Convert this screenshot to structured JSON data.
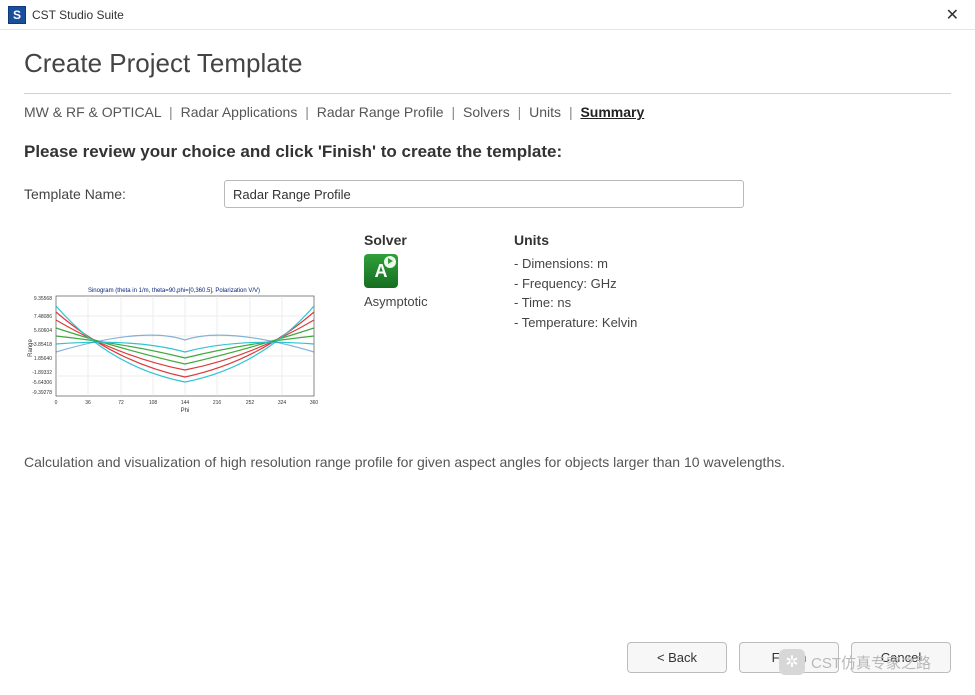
{
  "app": {
    "title": "CST Studio Suite"
  },
  "page": {
    "title": "Create Project Template"
  },
  "breadcrumbs": {
    "items": [
      {
        "label": "MW & RF & OPTICAL"
      },
      {
        "label": "Radar Applications"
      },
      {
        "label": "Radar Range Profile"
      },
      {
        "label": "Solvers"
      },
      {
        "label": "Units"
      },
      {
        "label": "Summary"
      }
    ],
    "sep": "|",
    "active_index": 5
  },
  "instruction": "Please review your choice and click 'Finish' to create the template:",
  "form": {
    "template_name_label": "Template Name:",
    "template_name_value": "Radar Range Profile"
  },
  "solver": {
    "heading": "Solver",
    "icon_letter": "A",
    "name": "Asymptotic"
  },
  "units": {
    "heading": "Units",
    "items": [
      "- Dimensions: m",
      "- Frequency: GHz",
      "- Time: ns",
      "- Temperature: Kelvin"
    ]
  },
  "description": "Calculation and visualization of high resolution range profile for given aspect angles for objects larger than 10 wavelengths.",
  "buttons": {
    "back": "< Back",
    "finish": "Finish",
    "cancel": "Cancel"
  },
  "watermark": {
    "text": "CST仿真专家之路"
  },
  "thumbnail": {
    "title": "Sinogram (theta in 1/m, theta=90,phi=[0,360.5], Polarization V/V)",
    "xlabel": "Phi",
    "ylabel": "Range"
  }
}
